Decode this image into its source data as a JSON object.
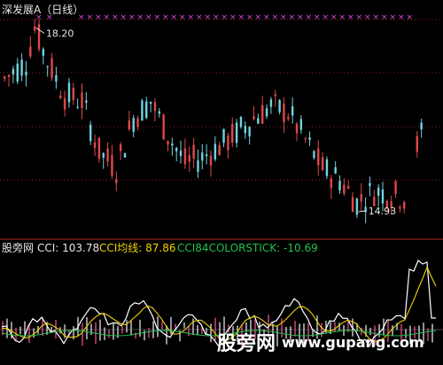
{
  "chart_data": [
    {
      "type": "candlestick",
      "title": "深发展A（日线）",
      "annotations": [
        {
          "label": "18.20",
          "x_index": 7,
          "price": 18.2
        },
        {
          "label": "14.93",
          "x_index": 82,
          "price": 14.93
        }
      ],
      "ylim": [
        14.6,
        18.35
      ],
      "n_bars": 98,
      "colors": {
        "up": "#e04848",
        "down": "#6fd3e0",
        "grid": "#8a1c1c",
        "marker": "#d94ad9"
      },
      "markers_row": "x markers along top"
    },
    {
      "type": "line",
      "title": "股旁网",
      "labels": {
        "cci": "CCI: 103.78",
        "cci_ma": "CCI均线: 87.86",
        "stick": "CCI84COLORSTICK: -10.69"
      },
      "series": [
        {
          "name": "CCI",
          "color": "#ffffff",
          "last": 103.78
        },
        {
          "name": "CCI均线",
          "color": "#f0d200",
          "last": 87.86
        },
        {
          "name": "CCI84COLORSTICK",
          "color": "#21c24a",
          "last": -10.69
        }
      ]
    }
  ],
  "watermark": {
    "cn": "股旁网",
    "url": "www.gupang.com"
  }
}
